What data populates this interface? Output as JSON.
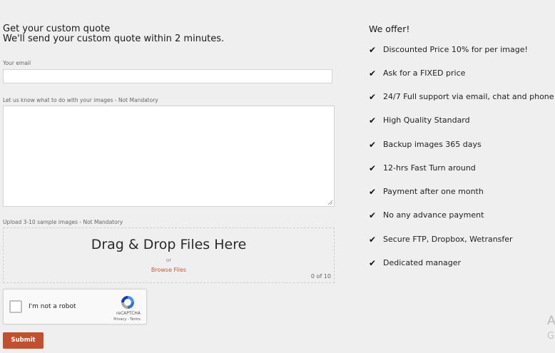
{
  "form": {
    "heading_line1": "Get your custom quote",
    "heading_line2": "We'll send your custom quote within 2 minutes.",
    "email_label": "Your email",
    "email_value": "",
    "message_label": "Let us know what to do with your images - Not Mandatory",
    "message_value": "",
    "upload_label": "Upload 3-10 sample images - Not Mandatory",
    "dropzone_title": "Drag & Drop Files Here",
    "dropzone_or": "or",
    "browse_label": "Browse Files",
    "file_count": "0 of 10",
    "captcha_label": "I'm not a robot",
    "captcha_brand": "reCAPTCHA",
    "captcha_links": "Privacy - Terms",
    "submit_label": "Submit"
  },
  "offers": {
    "title": "We offer!",
    "items": [
      "Discounted Price 10% for per image!",
      "Ask for a FIXED price",
      "24/7 Full support via email, chat and phone",
      "High Quality Standard",
      "Backup images 365 days",
      "12-hrs Fast Turn around",
      "Payment after one month",
      "No any advance payment",
      "Secure FTP, Dropbox, Wetransfer",
      "Dedicated manager"
    ],
    "check_glyph": "✔"
  },
  "corner": {
    "a": "A",
    "g": "G"
  },
  "colors": {
    "accent": "#c0502f",
    "link": "#c35a3a",
    "background": "#efefef"
  }
}
